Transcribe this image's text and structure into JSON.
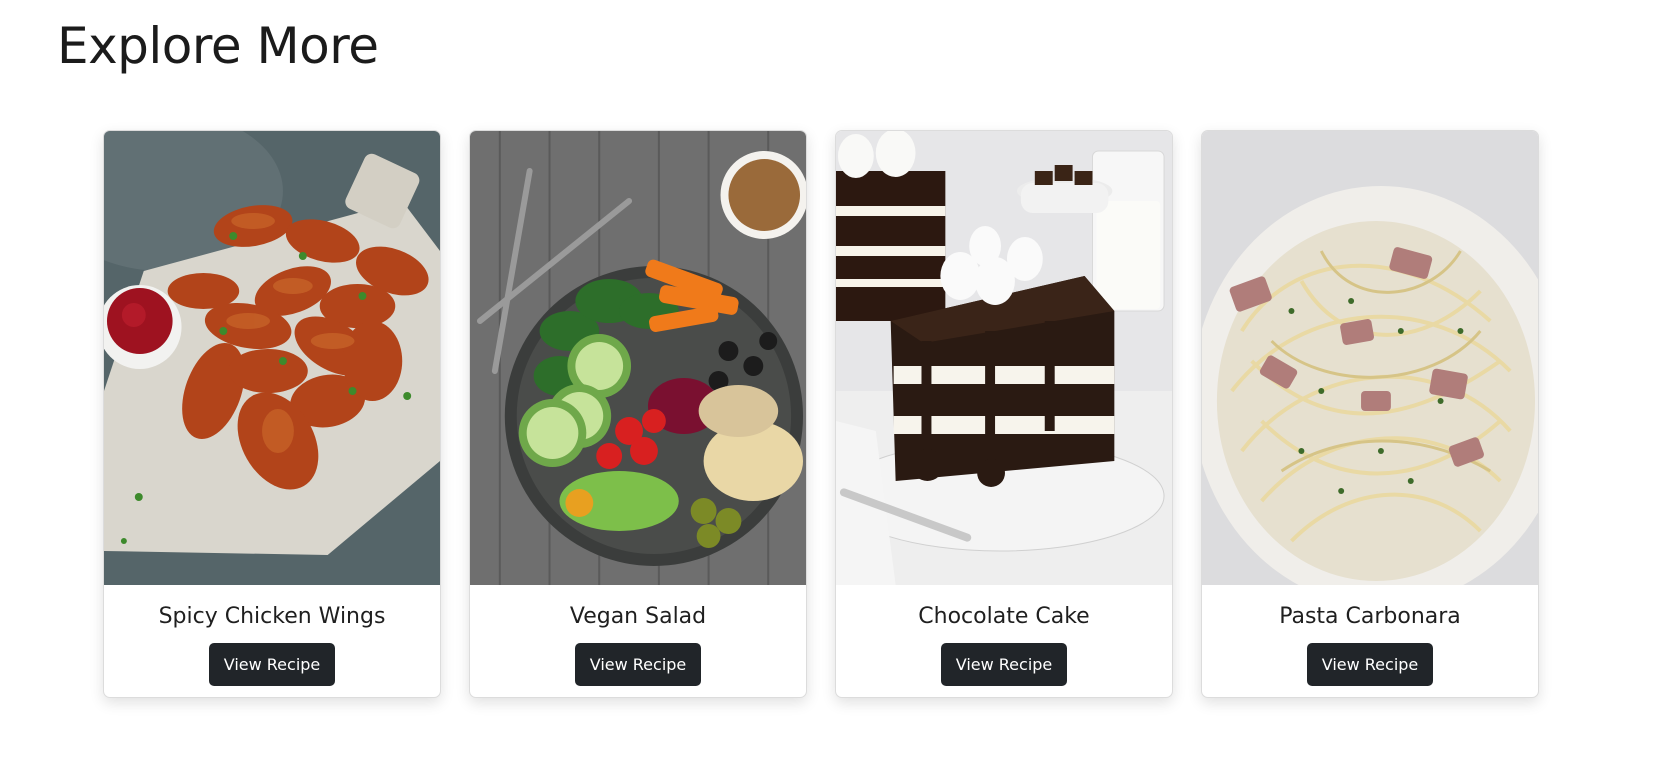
{
  "page": {
    "title": "Explore More"
  },
  "recipes": [
    {
      "title": "Spicy Chicken Wings",
      "button_label": "View Recipe",
      "image_icon": "chicken-wings-photo"
    },
    {
      "title": "Vegan Salad",
      "button_label": "View Recipe",
      "image_icon": "vegan-salad-photo"
    },
    {
      "title": "Chocolate Cake",
      "button_label": "View Recipe",
      "image_icon": "chocolate-cake-photo"
    },
    {
      "title": "Pasta Carbonara",
      "button_label": "View Recipe",
      "image_icon": "pasta-carbonara-photo"
    }
  ],
  "colors": {
    "button_bg": "#212529",
    "button_text": "#ffffff"
  }
}
